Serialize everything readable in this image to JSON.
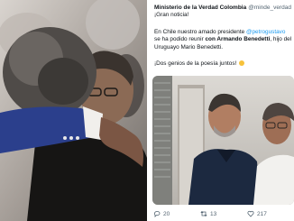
{
  "left_photo": {
    "icon": "embrace-photo"
  },
  "tweet": {
    "author_name": "Ministerio de la Verdad Colombia",
    "handle": "@minde_verdad",
    "line1": "¡Gran noticia!",
    "line2_a": "En Chile nuestro amado presidente ",
    "line2_mention": "@petrogustavo",
    "line3_a": "se ha podido reunir ",
    "line3_bold": "con Armando Benedetti",
    "line3_b": ", hijo del",
    "line4": "Uruguayo Mario Benedetti.",
    "line5": "¡Dos genios de la poesía juntos!",
    "emoji": "heart-eyes-emoji",
    "media": {
      "icon": "two-men-photo"
    },
    "actions": {
      "replies": "20",
      "retweets": "13",
      "likes": "217"
    }
  },
  "colors": {
    "mention": "#1d9bf0",
    "text": "#0f1419",
    "muted": "#536471"
  }
}
